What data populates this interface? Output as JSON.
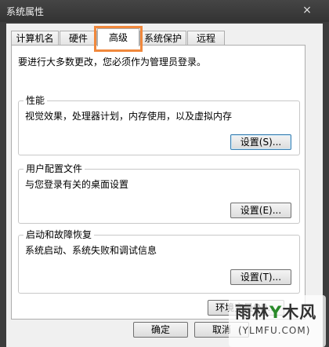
{
  "window": {
    "title": "系统属性",
    "close_glyph": "×"
  },
  "tabs": [
    {
      "label": "计算机名"
    },
    {
      "label": "硬件"
    },
    {
      "label": "高级"
    },
    {
      "label": "系统保护"
    },
    {
      "label": "远程"
    }
  ],
  "highlight_color": "#f0883c",
  "main": {
    "intro": "要进行大多数更改，您必须作为管理员登录。",
    "groups": [
      {
        "title": "性能",
        "desc": "视觉效果，处理器计划，内存使用，以及虚拟内存",
        "button": "设置(S)..."
      },
      {
        "title": "用户配置文件",
        "desc": "与您登录有关的桌面设置",
        "button": "设置(E)..."
      },
      {
        "title": "启动和故障恢复",
        "desc": "系统启动、系统失败和调试信息",
        "button": "设置(T)..."
      }
    ],
    "env_button": "环境变量(N)..."
  },
  "footer": {
    "ok": "确定",
    "cancel": "取消"
  },
  "watermark": {
    "text_a": "雨林",
    "text_y": "Y",
    "text_b": "木风",
    "url": "(YLMFU.COM)"
  }
}
